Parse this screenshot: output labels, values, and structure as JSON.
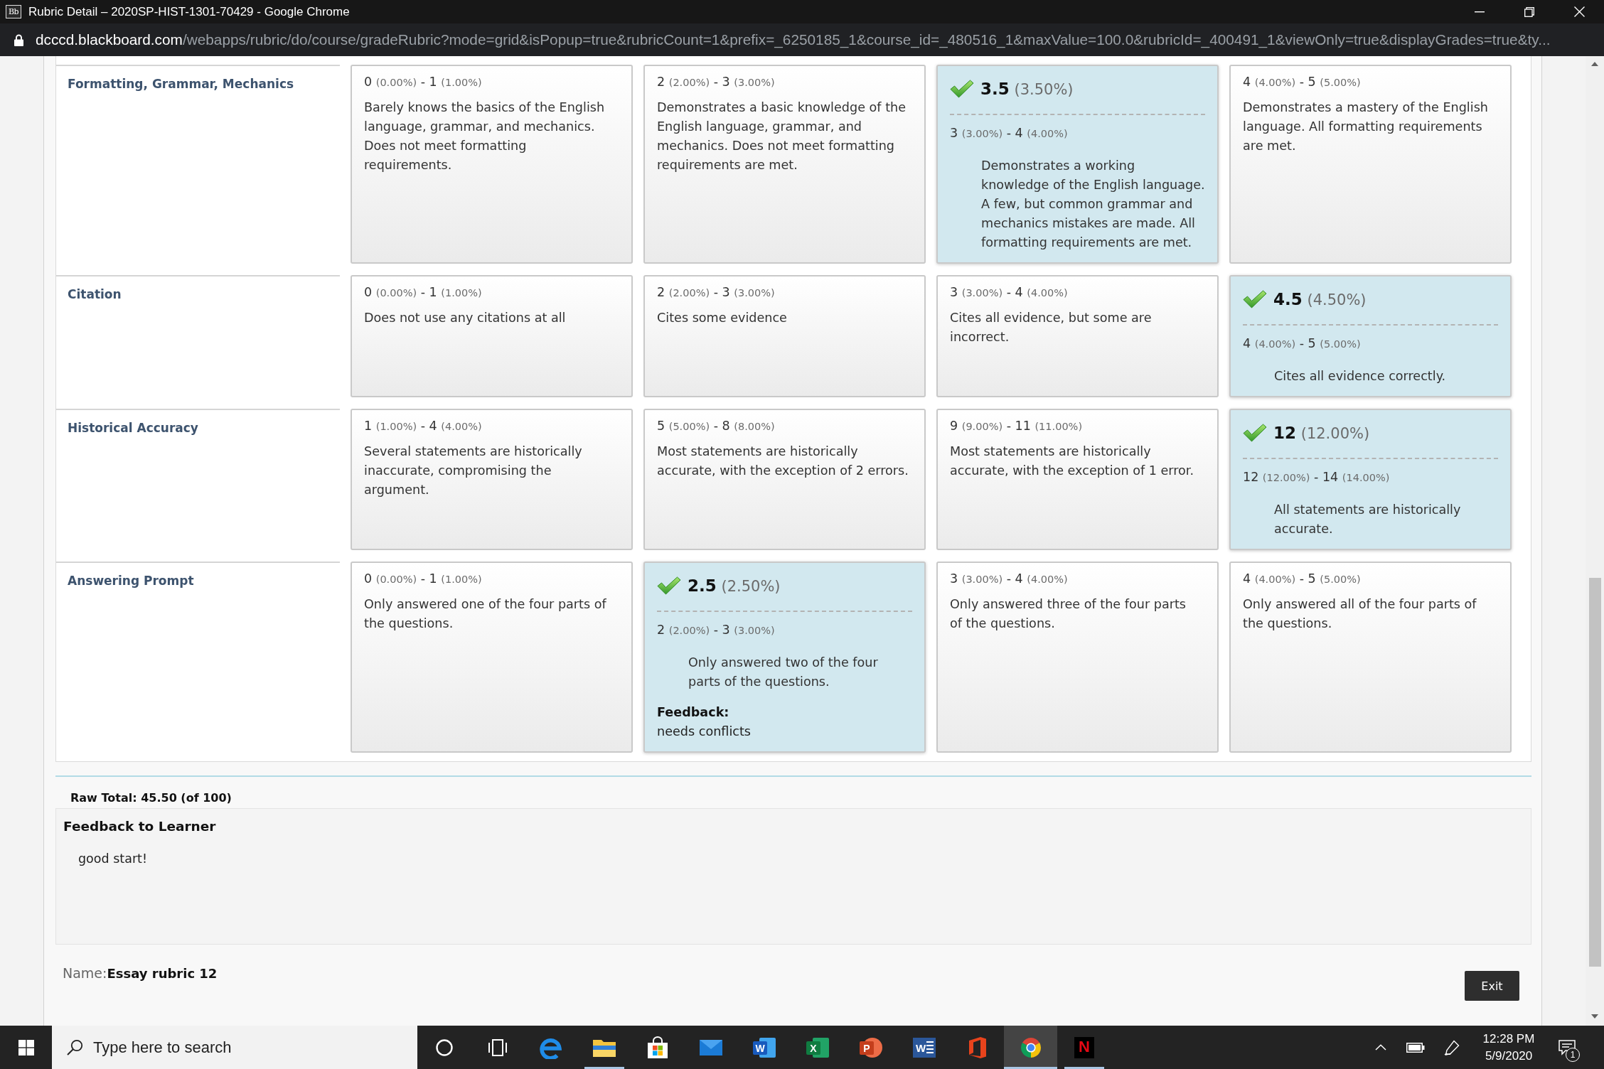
{
  "window": {
    "icon_text": "Bb",
    "title": "Rubric Detail – 2020SP-HIST-1301-70429 - Google Chrome"
  },
  "address_bar": {
    "domain": "dcccd.blackboard.com",
    "path": "/webapps/rubric/do/course/gradeRubric?mode=grid&isPopup=true&rubricCount=1&prefix=_6250185_1&course_id=_480516_1&maxValue=100.0&rubricId=_400491_1&viewOnly=true&displayGrades=true&ty..."
  },
  "rubric": {
    "rows": [
      {
        "criterion": "Formatting, Grammar, Mechanics",
        "levels": [
          {
            "selected": false,
            "range": {
              "low": "0",
              "low_percent": "(0.00%)",
              "separator": "-",
              "high": "1",
              "high_percent": "(1.00%)"
            },
            "description": "Barely knows the basics of the English language, grammar, and mechanics. Does not meet formatting requirements."
          },
          {
            "selected": false,
            "range": {
              "low": "2",
              "low_percent": "(2.00%)",
              "separator": "-",
              "high": "3",
              "high_percent": "(3.00%)"
            },
            "description": "Demonstrates a basic knowledge of the English language, grammar, and mechanics. Does not meet formatting requirements are met."
          },
          {
            "selected": true,
            "score": {
              "points": "3.5",
              "percent": "(3.50%)"
            },
            "range": {
              "low": "3",
              "low_percent": "(3.00%)",
              "separator": "-",
              "high": "4",
              "high_percent": "(4.00%)"
            },
            "description": "Demonstrates a working knowledge of the English language. A few, but common grammar and mechanics mistakes are made. All formatting requirements are met."
          },
          {
            "selected": false,
            "range": {
              "low": "4",
              "low_percent": "(4.00%)",
              "separator": "-",
              "high": "5",
              "high_percent": "(5.00%)"
            },
            "description": "Demonstrates a mastery of the English language. All formatting requirements are met."
          }
        ]
      },
      {
        "criterion": "Citation",
        "levels": [
          {
            "selected": false,
            "range": {
              "low": "0",
              "low_percent": "(0.00%)",
              "separator": "-",
              "high": "1",
              "high_percent": "(1.00%)"
            },
            "description": "Does not use any citations at all"
          },
          {
            "selected": false,
            "range": {
              "low": "2",
              "low_percent": "(2.00%)",
              "separator": "-",
              "high": "3",
              "high_percent": "(3.00%)"
            },
            "description": "Cites some evidence"
          },
          {
            "selected": false,
            "range": {
              "low": "3",
              "low_percent": "(3.00%)",
              "separator": "-",
              "high": "4",
              "high_percent": "(4.00%)"
            },
            "description": "Cites all evidence, but some are incorrect."
          },
          {
            "selected": true,
            "score": {
              "points": "4.5",
              "percent": "(4.50%)"
            },
            "range": {
              "low": "4",
              "low_percent": "(4.00%)",
              "separator": "-",
              "high": "5",
              "high_percent": "(5.00%)"
            },
            "description": "Cites all evidence correctly."
          }
        ]
      },
      {
        "criterion": "Historical Accuracy",
        "levels": [
          {
            "selected": false,
            "range": {
              "low": "1",
              "low_percent": "(1.00%)",
              "separator": "-",
              "high": "4",
              "high_percent": "(4.00%)"
            },
            "description": "Several statements are historically inaccurate, compromising the argument."
          },
          {
            "selected": false,
            "range": {
              "low": "5",
              "low_percent": "(5.00%)",
              "separator": "-",
              "high": "8",
              "high_percent": "(8.00%)"
            },
            "description": "Most statements are historically accurate, with the exception of 2 errors."
          },
          {
            "selected": false,
            "range": {
              "low": "9",
              "low_percent": "(9.00%)",
              "separator": "-",
              "high": "11",
              "high_percent": "(11.00%)"
            },
            "description": "Most statements are historically accurate, with the exception of 1 error."
          },
          {
            "selected": true,
            "score": {
              "points": "12",
              "percent": "(12.00%)"
            },
            "range": {
              "low": "12",
              "low_percent": "(12.00%)",
              "separator": "-",
              "high": "14",
              "high_percent": "(14.00%)"
            },
            "description": "All statements are historically accurate."
          }
        ]
      },
      {
        "criterion": "Answering Prompt",
        "levels": [
          {
            "selected": false,
            "range": {
              "low": "0",
              "low_percent": "(0.00%)",
              "separator": "-",
              "high": "1",
              "high_percent": "(1.00%)"
            },
            "description": "Only answered one of the four parts of the questions."
          },
          {
            "selected": true,
            "score": {
              "points": "2.5",
              "percent": "(2.50%)"
            },
            "range": {
              "low": "2",
              "low_percent": "(2.00%)",
              "separator": "-",
              "high": "3",
              "high_percent": "(3.00%)"
            },
            "description": "Only answered two of the four parts of the questions.",
            "feedback": {
              "label": "Feedback:",
              "text": "needs conflicts"
            }
          },
          {
            "selected": false,
            "range": {
              "low": "3",
              "low_percent": "(3.00%)",
              "separator": "-",
              "high": "4",
              "high_percent": "(4.00%)"
            },
            "description": "Only answered three of the four parts of the questions."
          },
          {
            "selected": false,
            "range": {
              "low": "4",
              "low_percent": "(4.00%)",
              "separator": "-",
              "high": "5",
              "high_percent": "(5.00%)"
            },
            "description": "Only answered all of the four parts of the questions."
          }
        ]
      }
    ]
  },
  "raw_total": "Raw Total: 45.50 (of 100)",
  "feedback_to_learner": {
    "heading": "Feedback to Learner",
    "text": "good start!"
  },
  "rubric_name": "Name:**Essay rubric 12**",
  "buttons": [
    {
      "label": "Exit"
    }
  ],
  "taskbar": {
    "search": {
      "placeholder": "Type here to search"
    },
    "apps": [
      {
        "kind": "cortana",
        "running": false,
        "active": false
      },
      {
        "kind": "task-view",
        "running": false,
        "active": false
      },
      {
        "kind": "edge",
        "running": false,
        "active": false
      },
      {
        "kind": "file-explorer",
        "running": true,
        "active": false
      },
      {
        "kind": "store",
        "running": false,
        "active": false
      },
      {
        "kind": "mail",
        "running": false,
        "active": false
      },
      {
        "kind": "word",
        "letter": "W",
        "running": false,
        "active": false
      },
      {
        "kind": "excel",
        "letter": "X",
        "running": false,
        "active": false
      },
      {
        "kind": "powerpoint",
        "letter": "P",
        "running": false,
        "active": false
      },
      {
        "kind": "word-classic",
        "letter": "W",
        "running": false,
        "active": false
      },
      {
        "kind": "office",
        "running": false,
        "active": false
      },
      {
        "kind": "chrome",
        "running": true,
        "active": true
      },
      {
        "kind": "netflix",
        "letter": "N",
        "running": true,
        "active": false
      }
    ],
    "clock": {
      "time": "12:28 PM",
      "date": "5/9/2020"
    },
    "notifications": {
      "count": "1"
    }
  }
}
